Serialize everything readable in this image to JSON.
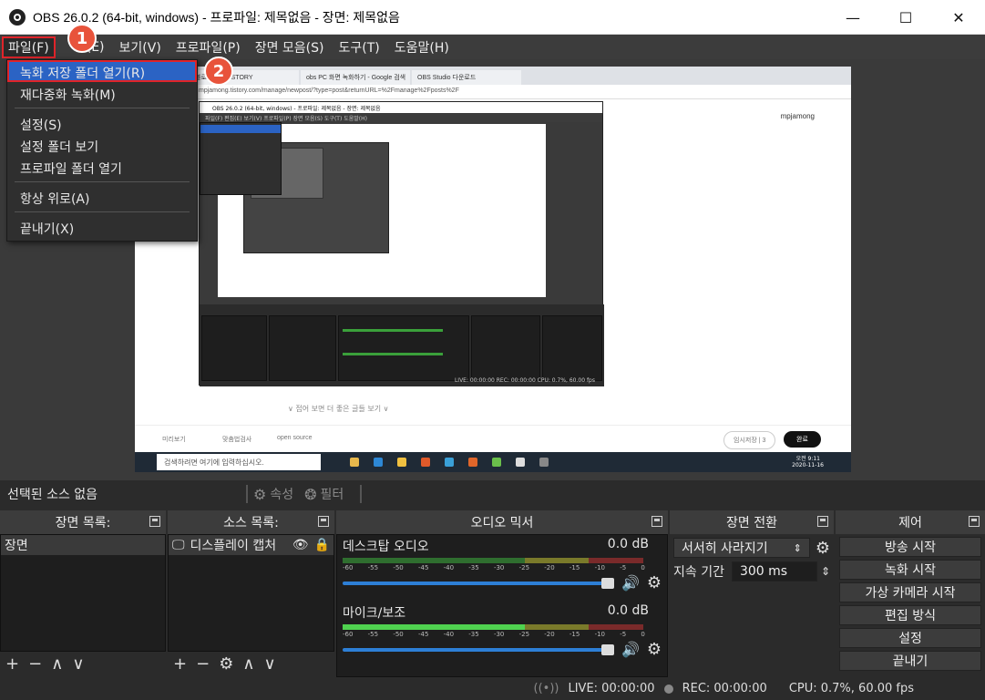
{
  "window": {
    "title": "OBS 26.0.2 (64-bit, windows) - 프로파일: 제목없음 - 장면: 제목없음",
    "minimize": "—",
    "maximize": "☐",
    "close": "✕"
  },
  "menubar": {
    "items": [
      "파일(F)",
      "편집(E)",
      "보기(V)",
      "프로파일(P)",
      "장면 모음(S)",
      "도구(T)",
      "도움말(H)"
    ],
    "edit_visible": "(E)"
  },
  "file_menu": {
    "items": [
      "녹화 저장 폴더 열기(R)",
      "재다중화 녹화(M)",
      "설정(S)",
      "설정 폴더 보기",
      "프로파일 폴더 열기",
      "항상 위로(A)",
      "끝내기(X)"
    ]
  },
  "badges": {
    "one": "1",
    "two": "2"
  },
  "preview": {
    "tabs": [
      "블로 날씨 | TISTORY",
      "obs PC 화면 녹화하기 - Google 검색",
      "OBS Studio 다운로드"
    ],
    "address": "mpjamong.tistory.com/manage/newpost/?type=post&returnURL=%2Fmanage%2Fposts%2F",
    "site_name": "mpjamong",
    "more_text": "∨ 접어 보면 더 좋은 글들 보기 ∨",
    "footer_left": "미리보기",
    "footer_mid": "맞춤법검사",
    "footer_open": "open source",
    "footer_save": "임시저장 | 3",
    "footer_publish": "완료",
    "taskbar_search": "검색하려면 여기에 입력하십시오.",
    "taskbar_time": "오전 9:11",
    "taskbar_date": "2020-11-16",
    "nested_title": "OBS 26.0.2 (64-bit, windows) - 프로파일: 제목없음 - 장면: 제목없음",
    "nested_menu": "파일(F) 편집(E) 보기(V) 프로파일(P) 장면 모음(S) 도구(T) 도움말(H)",
    "nested_status": "LIVE: 00:00:00   REC: 00:00:00   CPU: 0.7%, 60.00 fps"
  },
  "sourcebar": {
    "no_source": "선택된 소스 없음",
    "properties": "속성",
    "filters": "필터"
  },
  "scenes": {
    "title": "장면 목록:",
    "items": [
      "장면"
    ]
  },
  "sources": {
    "title": "소스 목록:",
    "items": [
      "디스플레이 캡처"
    ]
  },
  "mixer": {
    "title": "오디오 믹서",
    "channels": [
      {
        "name": "데스크탑 오디오",
        "db": "0.0 dB",
        "volume": 1.0
      },
      {
        "name": "마이크/보조",
        "db": "0.0 dB",
        "volume": 1.0
      }
    ],
    "scale": [
      "-60",
      "-55",
      "-50",
      "-45",
      "-40",
      "-35",
      "-30",
      "-25",
      "-20",
      "-15",
      "-10",
      "-5",
      "0"
    ]
  },
  "transitions": {
    "title": "장면 전환",
    "selected": "서서히 사라지기",
    "duration_label": "지속 기간",
    "duration_value": "300 ms"
  },
  "controls": {
    "title": "제어",
    "buttons": [
      "방송 시작",
      "녹화 시작",
      "가상 카메라 시작",
      "편집 방식",
      "설정",
      "끝내기"
    ]
  },
  "status": {
    "live": "LIVE: 00:00:00",
    "rec": "REC: 00:00:00",
    "cpu": "CPU: 0.7%, 60.00 fps"
  },
  "colors": {
    "highlight_red": "#e0242a",
    "selection_blue": "#2b63c4",
    "badge": "#e8533b"
  }
}
